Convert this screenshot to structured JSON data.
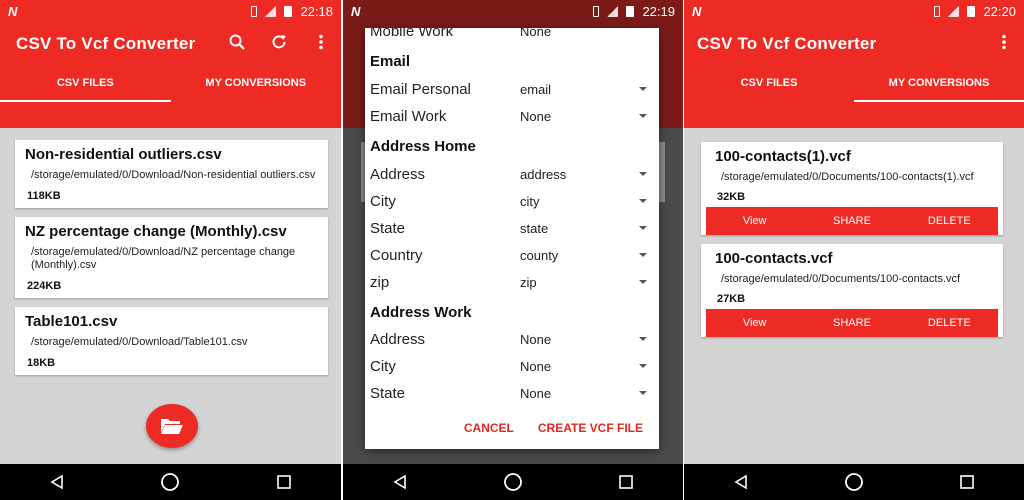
{
  "app": {
    "title": "CSV To Vcf Converter"
  },
  "status": {
    "time_1": "22:18",
    "time_2": "22:19",
    "time_3": "22:20"
  },
  "tabs": {
    "csv_files": "CSV FILES",
    "my_conversions": "MY CONVERSIONS"
  },
  "csv_files": [
    {
      "name": "Non-residential outliers.csv",
      "path": "/storage/emulated/0/Download/Non-residential outliers.csv",
      "size": "118KB"
    },
    {
      "name": "NZ percentage change (Monthly).csv",
      "path": "/storage/emulated/0/Download/NZ percentage change (Monthly).csv",
      "size": "224KB"
    },
    {
      "name": "Table101.csv",
      "path": "/storage/emulated/0/Download/Table101.csv",
      "size": "18KB"
    }
  ],
  "dialog": {
    "partial_row": {
      "label": "Mobile Work",
      "value": "None"
    },
    "sections": {
      "email": "Email",
      "address_home": "Address Home",
      "address_work": "Address Work"
    },
    "email_rows": [
      {
        "label": "Email Personal",
        "value": "email"
      },
      {
        "label": "Email Work",
        "value": "None"
      }
    ],
    "home_rows": [
      {
        "label": "Address",
        "value": "address"
      },
      {
        "label": "City",
        "value": "city"
      },
      {
        "label": "State",
        "value": "state"
      },
      {
        "label": "Country",
        "value": "county"
      },
      {
        "label": "zip",
        "value": "zip"
      }
    ],
    "work_rows": [
      {
        "label": "Address",
        "value": "None"
      },
      {
        "label": "City",
        "value": "None"
      },
      {
        "label": "State",
        "value": "None"
      }
    ],
    "cancel": "CANCEL",
    "create": "CREATE VCF FILE"
  },
  "conversions": [
    {
      "name": "100-contacts(1).vcf",
      "path": "/storage/emulated/0/Documents/100-contacts(1).vcf",
      "size": "32KB"
    },
    {
      "name": "100-contacts.vcf",
      "path": "/storage/emulated/0/Documents/100-contacts.vcf",
      "size": "27KB"
    }
  ],
  "conversion_actions": {
    "view": "View",
    "share": "SHARE",
    "delete": "DELETE"
  },
  "colors": {
    "primary": "#ee2a24",
    "background": "#d4d4d4",
    "navbar": "#000000"
  },
  "icons": [
    "search-icon",
    "refresh-icon",
    "more-vert-icon",
    "folder-open-icon",
    "back-icon",
    "home-icon",
    "recents-icon"
  ]
}
